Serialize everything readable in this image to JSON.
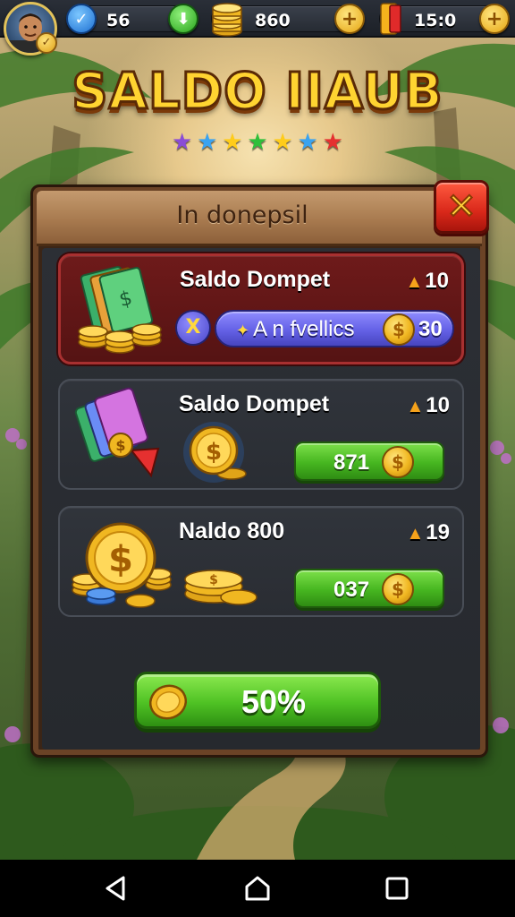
{
  "colors": {
    "accent_gold": "#ffd431",
    "featured_red": "#6e1a1a",
    "green_button": "#46b620",
    "purple_button": "#6461e6",
    "close_red": "#d9281a"
  },
  "header": {
    "avatar_icon": "player-avatar",
    "stats": [
      {
        "icon": "check-icon",
        "value": "56"
      },
      {
        "icon": "coin-stack-icon",
        "value": "860"
      },
      {
        "icon": "ticket-icon",
        "value": "15:0"
      }
    ]
  },
  "title": {
    "text": "SALDO IIAUB",
    "stars": [
      "#8a4cd6",
      "#3aa3f0",
      "#ffcc1a",
      "#2fbf3a",
      "#ffcc1a",
      "#3aa3f0",
      "#e53030"
    ]
  },
  "dialog": {
    "title": "In donepsil",
    "close_label": "✕",
    "offers": [
      {
        "name": "Saldo Dompet",
        "bonus": "10",
        "featured": true,
        "tag_label": "X",
        "button_label": "A n fvellics",
        "button_amount": "30"
      },
      {
        "name": "Saldo Dompet",
        "bonus": "10",
        "price": "871"
      },
      {
        "name": "Naldo 800",
        "bonus": "19",
        "price": "037"
      }
    ],
    "cta_label": "50%"
  },
  "navbar": {
    "back_icon": "back-triangle-icon",
    "home_icon": "home-icon",
    "recents_icon": "recents-square-icon"
  }
}
